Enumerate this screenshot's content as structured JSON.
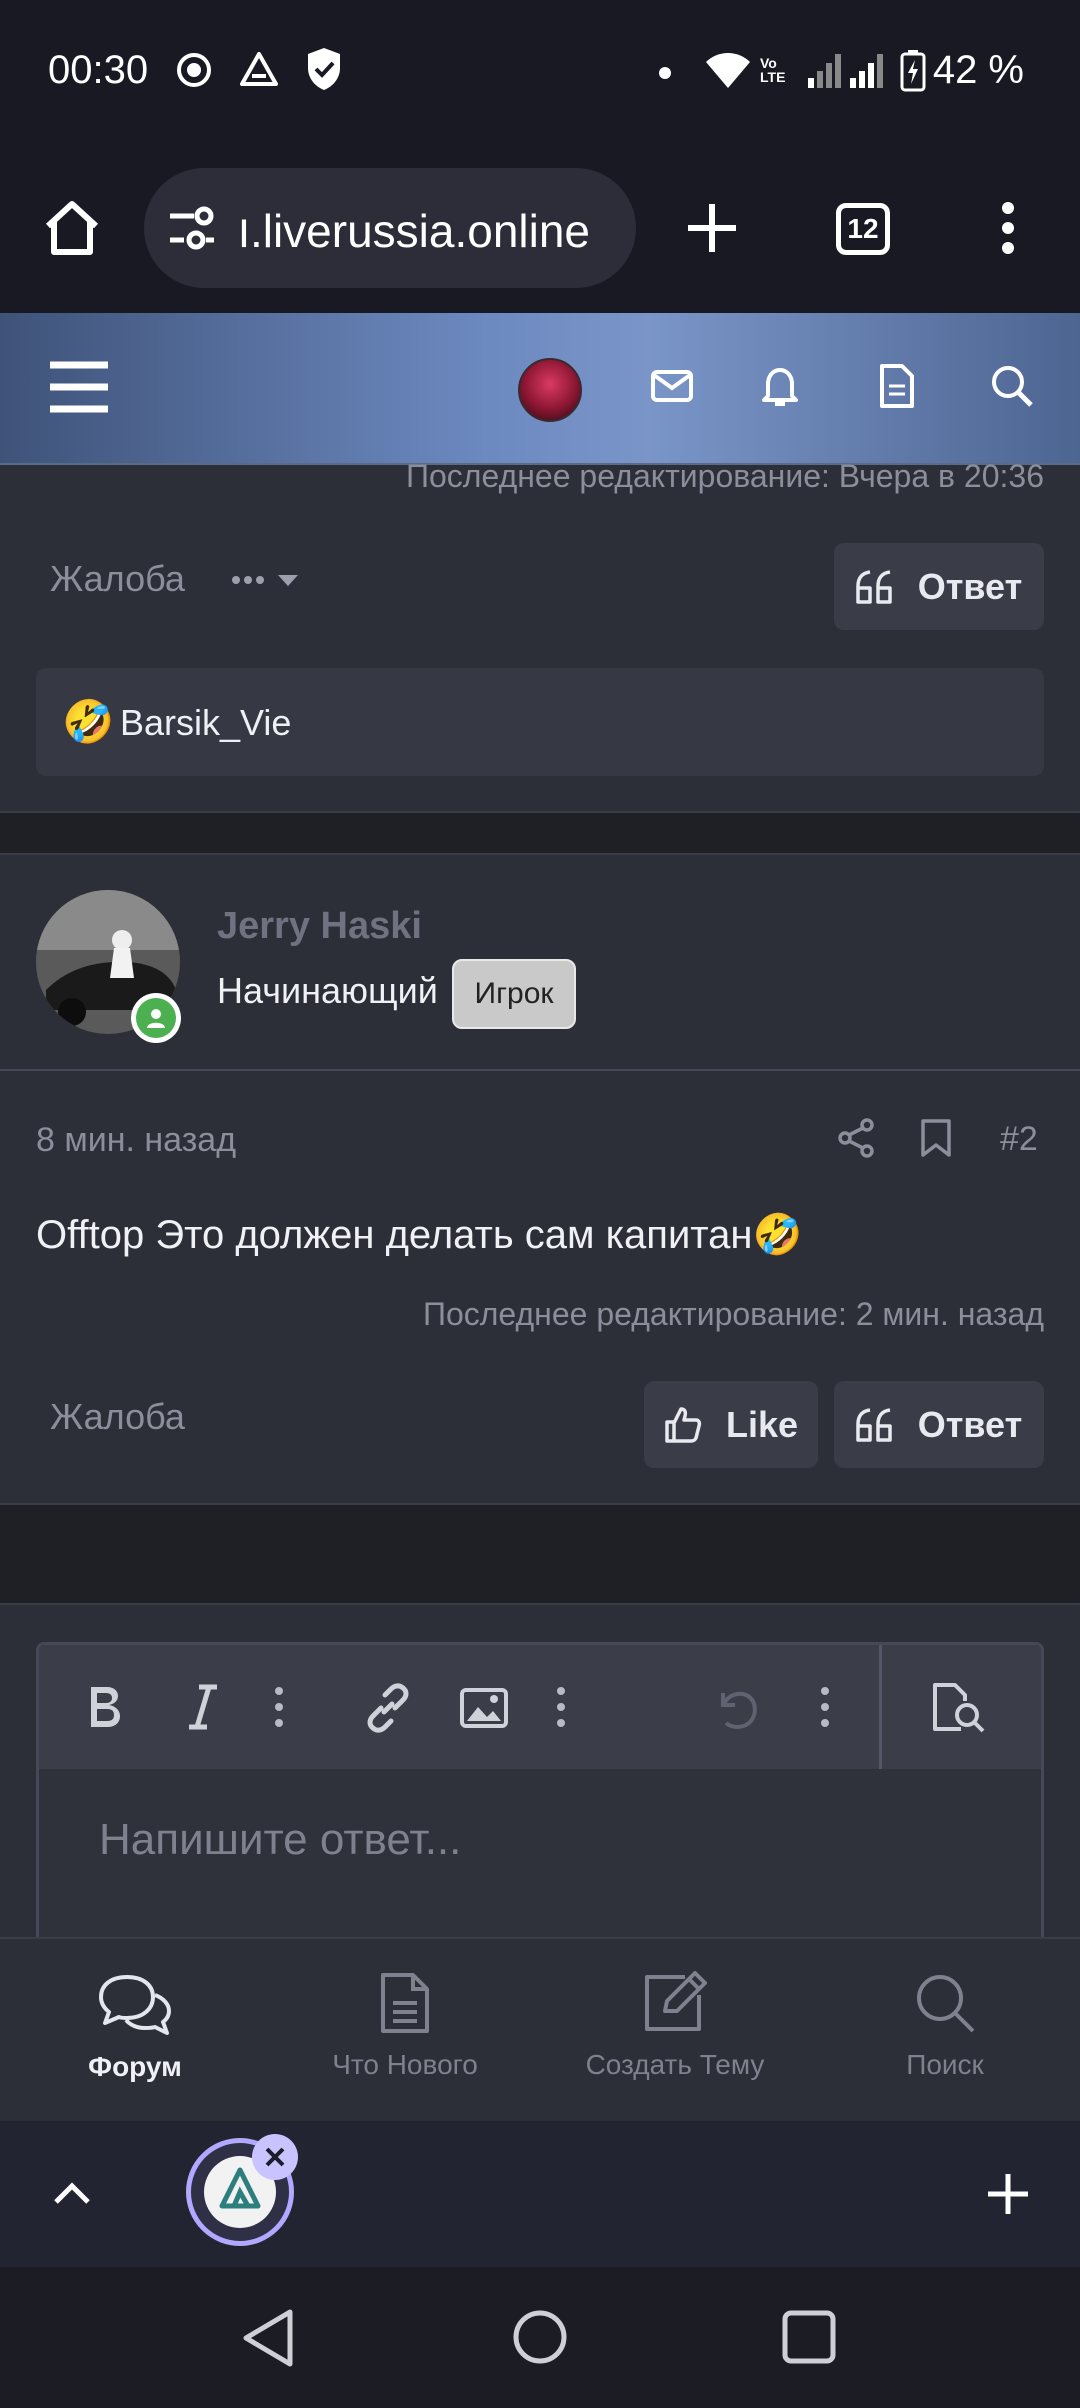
{
  "status_bar": {
    "time": "00:30",
    "battery": "42 %",
    "icons": [
      "record-icon",
      "drive-icon",
      "shield-icon",
      "dot-icon",
      "wifi-icon",
      "volte-icon",
      "signal-icon",
      "signal-icon",
      "battery-charging-icon"
    ]
  },
  "browser": {
    "url": "ו.liverussia.online",
    "tab_count": "12"
  },
  "forum_header": {
    "icons": [
      "menu-icon",
      "avatar",
      "mail-icon",
      "bell-icon",
      "document-icon",
      "search-icon"
    ]
  },
  "post1": {
    "edit_note": "Последнее редактирование: Вчера в 20:36",
    "report_label": "Жалоба",
    "reply_label": "Ответ",
    "reaction_user": "Barsik_Vie",
    "reaction_emoji": "🤣"
  },
  "post2": {
    "username": "Jerry Haski",
    "user_title": "Начинающий",
    "badge": "Игрок",
    "time": "8 мин. назад",
    "post_number": "#2",
    "body": "Offtop Это должен делать сам капитан🤣",
    "edit_note": "Последнее редактирование: 2 мин. назад",
    "report_label": "Жалоба",
    "like_label": "Like",
    "reply_label": "Ответ"
  },
  "editor": {
    "placeholder": "Напишите ответ..."
  },
  "bottom_nav": {
    "items": [
      {
        "label": "Форум",
        "icon": "chat-icon",
        "active": true
      },
      {
        "label": "Что Нового",
        "icon": "document-icon",
        "active": false
      },
      {
        "label": "Создать Тему",
        "icon": "edit-icon",
        "active": false
      },
      {
        "label": "Поиск",
        "icon": "search-icon",
        "active": false
      }
    ]
  }
}
